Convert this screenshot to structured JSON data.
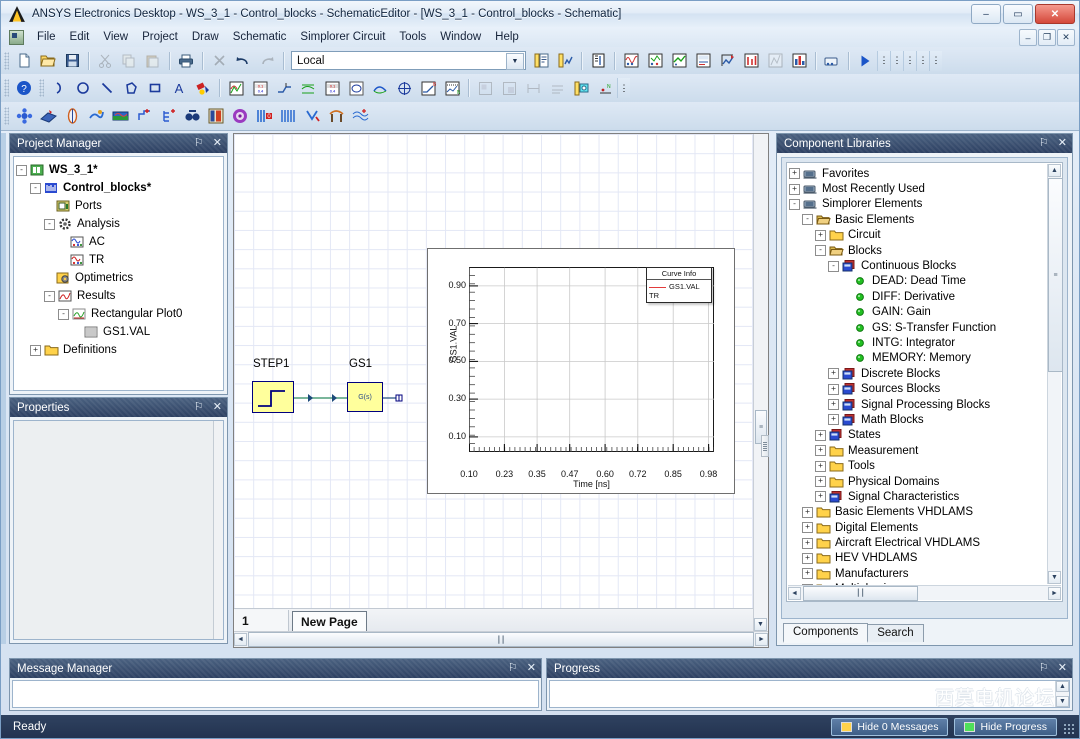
{
  "window": {
    "title": "ANSYS Electronics Desktop - WS_3_1 - Control_blocks - SchematicEditor - [WS_3_1 - Control_blocks - Schematic]",
    "logo_name": "ansys-logo",
    "minimize": "–",
    "maximize": "▭",
    "close": "✕",
    "mdi_minimize": "–",
    "mdi_restore": "❐",
    "mdi_close": "✕"
  },
  "menu": {
    "items": [
      "File",
      "Edit",
      "View",
      "Project",
      "Draw",
      "Schematic",
      "Simplorer Circuit",
      "Tools",
      "Window",
      "Help"
    ]
  },
  "toolbar": {
    "design_combo_value": "Local",
    "design_combo_placeholder": "Local",
    "row1": [
      {
        "name": "new-icon",
        "label": "New"
      },
      {
        "name": "open-icon",
        "label": "Open"
      },
      {
        "name": "save-icon",
        "label": "Save"
      },
      {
        "name": "cut-icon",
        "label": "Cut"
      },
      {
        "name": "copy-icon",
        "label": "Copy"
      },
      {
        "name": "paste-icon",
        "label": "Paste"
      },
      {
        "name": "print-icon",
        "label": "Print"
      },
      {
        "name": "delete-icon",
        "label": "Delete"
      },
      {
        "name": "undo-icon",
        "label": "Undo"
      },
      {
        "name": "redo-icon",
        "label": "Redo"
      }
    ],
    "row1b": [
      {
        "name": "validate-icon",
        "label": "Validate"
      },
      {
        "name": "analyze-all-icon",
        "label": "Analyze All"
      },
      {
        "name": "edit-notes-icon",
        "label": "Edit Notes"
      },
      {
        "name": "sim-setup-icon",
        "label": "Simulation Setup"
      },
      {
        "name": "results-icon",
        "label": "Results"
      },
      {
        "name": "solution-data-icon",
        "label": "Solution Data"
      },
      {
        "name": "output-variables-icon",
        "label": "Output Variables"
      },
      {
        "name": "param-sweep-icon",
        "label": "Parametric Sweep"
      },
      {
        "name": "optimization-icon",
        "label": "Optimization"
      },
      {
        "name": "sensitivity-icon",
        "label": "Sensitivity"
      },
      {
        "name": "statistical-icon",
        "label": "Statistical"
      },
      {
        "name": "run-icon",
        "label": "Run Simulation"
      }
    ],
    "row2": [
      {
        "name": "help-icon",
        "label": "Help"
      },
      {
        "name": "draw-arc-icon",
        "label": "Draw Arc"
      },
      {
        "name": "draw-circle-icon",
        "label": "Draw Circle"
      },
      {
        "name": "draw-line-icon",
        "label": "Draw Line"
      },
      {
        "name": "draw-polygon-icon",
        "label": "Draw Polygon"
      },
      {
        "name": "draw-rectangle-icon",
        "label": "Draw Rectangle"
      },
      {
        "name": "draw-text-icon",
        "label": "Draw Text"
      },
      {
        "name": "fill-color-icon",
        "label": "Fill Color"
      },
      {
        "name": "plot-xy-icon",
        "label": "Create Rectangular Plot"
      },
      {
        "name": "table-report-icon",
        "label": "Create Data Table"
      },
      {
        "name": "marker-icon",
        "label": "Add Marker"
      },
      {
        "name": "trace-icon",
        "label": "Add Trace"
      },
      {
        "name": "data-table-icon",
        "label": "Data Table"
      },
      {
        "name": "circle-plot-icon",
        "label": "Circle Plot"
      },
      {
        "name": "eye-diagram-icon",
        "label": "Eye Diagram"
      },
      {
        "name": "crosshair-icon",
        "label": "Crosshair"
      },
      {
        "name": "bode-plot-icon",
        "label": "Bode Plot"
      },
      {
        "name": "noise-plot-icon",
        "label": "Noise Plot"
      },
      {
        "name": "align-icon",
        "label": "Align"
      },
      {
        "name": "distribute-icon",
        "label": "Distribute"
      },
      {
        "name": "measure-icon",
        "label": "Measure"
      },
      {
        "name": "grid-icon",
        "label": "Grid"
      },
      {
        "name": "snap-icon",
        "label": "Snap"
      },
      {
        "name": "coord-icon",
        "label": "Coordinates"
      }
    ],
    "row3": [
      {
        "name": "twin-builder-icon",
        "label": "Twin Builder"
      },
      {
        "name": "maxwell-icon",
        "label": "Maxwell"
      },
      {
        "name": "hfss-icon",
        "label": "HFSS"
      },
      {
        "name": "q3d-icon",
        "label": "Q3D Extractor"
      },
      {
        "name": "icepak-icon",
        "label": "Icepak"
      },
      {
        "name": "circuit-add-icon",
        "label": "Add Circuit"
      },
      {
        "name": "netlist-add-icon",
        "label": "Add Netlist"
      },
      {
        "name": "emit-icon",
        "label": "EMIT"
      },
      {
        "name": "rmxprt-icon",
        "label": "RMxprt"
      },
      {
        "name": "pexprt-icon",
        "label": "PExprt"
      },
      {
        "name": "maxwell-2d-icon",
        "label": "Maxwell 2D"
      },
      {
        "name": "maxwell-3d-icon",
        "label": "Maxwell 3D"
      },
      {
        "name": "import-icon",
        "label": "Import"
      },
      {
        "name": "antenna-icon",
        "label": "Antenna"
      },
      {
        "name": "waveform-icon",
        "label": "Waveform"
      }
    ]
  },
  "project_manager": {
    "title": "Project Manager",
    "pin": "⚐",
    "close": "✕",
    "tree": [
      {
        "depth": 0,
        "expander": "-",
        "icon": "project-icon",
        "label": "WS_3_1*",
        "bold": true
      },
      {
        "depth": 1,
        "expander": "-",
        "icon": "design-icon",
        "label": "Control_blocks*",
        "bold": true
      },
      {
        "depth": 2,
        "expander": "",
        "icon": "ports-icon",
        "label": "Ports",
        "bold": false
      },
      {
        "depth": 2,
        "expander": "-",
        "icon": "analysis-icon",
        "label": "Analysis",
        "bold": false
      },
      {
        "depth": 3,
        "expander": "",
        "icon": "ac-setup-icon",
        "label": "AC",
        "bold": false
      },
      {
        "depth": 3,
        "expander": "",
        "icon": "tr-setup-icon",
        "label": "TR",
        "bold": false
      },
      {
        "depth": 2,
        "expander": "",
        "icon": "optimetrics-icon",
        "label": "Optimetrics",
        "bold": false
      },
      {
        "depth": 2,
        "expander": "-",
        "icon": "results-icon",
        "label": "Results",
        "bold": false
      },
      {
        "depth": 3,
        "expander": "-",
        "icon": "rect-plot-icon",
        "label": "Rectangular Plot0",
        "bold": false
      },
      {
        "depth": 4,
        "expander": "",
        "icon": "trace-icon",
        "label": "GS1.VAL",
        "bold": false
      },
      {
        "depth": 1,
        "expander": "+",
        "icon": "folder-icon",
        "label": "Definitions",
        "bold": false
      }
    ]
  },
  "properties": {
    "title": "Properties",
    "pin": "⚐",
    "close": "✕"
  },
  "component_libraries": {
    "title": "Component Libraries",
    "pin": "⚐",
    "close": "✕",
    "tree": [
      {
        "depth": 0,
        "expander": "+",
        "icon": "library-icon",
        "label": "Favorites"
      },
      {
        "depth": 0,
        "expander": "+",
        "icon": "library-icon",
        "label": "Most Recently Used"
      },
      {
        "depth": 0,
        "expander": "-",
        "icon": "library-icon",
        "label": "Simplorer Elements"
      },
      {
        "depth": 1,
        "expander": "-",
        "icon": "folder-open-icon",
        "label": "Basic Elements"
      },
      {
        "depth": 2,
        "expander": "+",
        "icon": "folder-icon",
        "label": "Circuit"
      },
      {
        "depth": 2,
        "expander": "-",
        "icon": "folder-open-icon",
        "label": "Blocks"
      },
      {
        "depth": 3,
        "expander": "-",
        "icon": "block-group-icon",
        "label": "Continuous Blocks"
      },
      {
        "depth": 4,
        "expander": "",
        "icon": "green-dot-icon",
        "label": "DEAD: Dead Time"
      },
      {
        "depth": 4,
        "expander": "",
        "icon": "green-dot-icon",
        "label": "DIFF: Derivative"
      },
      {
        "depth": 4,
        "expander": "",
        "icon": "green-dot-icon",
        "label": "GAIN: Gain"
      },
      {
        "depth": 4,
        "expander": "",
        "icon": "green-dot-icon",
        "label": "GS: S-Transfer Function"
      },
      {
        "depth": 4,
        "expander": "",
        "icon": "green-dot-icon",
        "label": "INTG: Integrator"
      },
      {
        "depth": 4,
        "expander": "",
        "icon": "green-dot-icon",
        "label": "MEMORY: Memory"
      },
      {
        "depth": 3,
        "expander": "+",
        "icon": "block-group-icon",
        "label": "Discrete Blocks"
      },
      {
        "depth": 3,
        "expander": "+",
        "icon": "block-group-icon",
        "label": "Sources Blocks"
      },
      {
        "depth": 3,
        "expander": "+",
        "icon": "block-group-icon",
        "label": "Signal Processing Blocks"
      },
      {
        "depth": 3,
        "expander": "+",
        "icon": "block-group-icon",
        "label": "Math Blocks"
      },
      {
        "depth": 2,
        "expander": "+",
        "icon": "block-group-icon",
        "label": "States"
      },
      {
        "depth": 2,
        "expander": "+",
        "icon": "folder-icon",
        "label": "Measurement"
      },
      {
        "depth": 2,
        "expander": "+",
        "icon": "folder-icon",
        "label": "Tools"
      },
      {
        "depth": 2,
        "expander": "+",
        "icon": "folder-icon",
        "label": "Physical Domains"
      },
      {
        "depth": 2,
        "expander": "+",
        "icon": "block-group-icon",
        "label": "Signal Characteristics"
      },
      {
        "depth": 1,
        "expander": "+",
        "icon": "folder-icon",
        "label": "Basic Elements VHDLAMS"
      },
      {
        "depth": 1,
        "expander": "+",
        "icon": "folder-icon",
        "label": "Digital Elements"
      },
      {
        "depth": 1,
        "expander": "+",
        "icon": "folder-icon",
        "label": "Aircraft Electrical VHDLAMS"
      },
      {
        "depth": 1,
        "expander": "+",
        "icon": "folder-icon",
        "label": "HEV VHDLAMS"
      },
      {
        "depth": 1,
        "expander": "+",
        "icon": "folder-icon",
        "label": "Manufacturers"
      },
      {
        "depth": 1,
        "expander": "+",
        "icon": "folder-icon",
        "label": "Multiphysics"
      }
    ],
    "tabs": [
      {
        "label": "Components",
        "active": true
      },
      {
        "label": "Search",
        "active": false
      }
    ]
  },
  "schematic": {
    "components": [
      {
        "name": "STEP1",
        "type": "step-source"
      },
      {
        "name": "GS1",
        "type": "s-transfer-function",
        "body_label": "G(s)"
      }
    ],
    "page_number": "1",
    "page_tab": "New Page"
  },
  "chart_data": {
    "type": "line",
    "title": "",
    "xlabel": "Time [ns]",
    "ylabel": "GS1.VAL",
    "xlim": [
      0.1,
      1.0
    ],
    "ylim": [
      0.02,
      1.0
    ],
    "xticks": [
      "0.10",
      "0.23",
      "0.35",
      "0.47",
      "0.60",
      "0.72",
      "0.85",
      "0.98"
    ],
    "xtick_values": [
      0.1,
      0.23,
      0.35,
      0.47,
      0.6,
      0.72,
      0.85,
      0.98
    ],
    "yticks": [
      "0.10",
      "0.30",
      "0.50",
      "0.70",
      "0.90"
    ],
    "ytick_values": [
      0.1,
      0.3,
      0.5,
      0.7,
      0.9
    ],
    "grid": true,
    "legend": {
      "title": "Curve Info",
      "position": "top-right",
      "entries": [
        {
          "name": "GS1.VAL",
          "sub": "TR",
          "color": "#e23b3b"
        }
      ]
    },
    "series": [
      {
        "name": "GS1.VAL",
        "color": "#1a1a1a",
        "x": [
          0.1,
          0.23,
          0.35,
          0.47,
          0.6,
          0.72,
          0.85,
          0.98,
          1.0
        ],
        "values": [
          1.0,
          1.0,
          1.0,
          1.0,
          1.0,
          1.0,
          1.0,
          1.0,
          1.0
        ]
      }
    ]
  },
  "message_manager": {
    "title": "Message Manager",
    "pin": "⚐",
    "close": "✕"
  },
  "progress": {
    "title": "Progress",
    "pin": "⚐",
    "close": "✕",
    "watermark": "西莫电机论坛"
  },
  "statusbar": {
    "text": "Ready",
    "hide_messages": "Hide 0 Messages",
    "hide_progress": "Hide Progress"
  },
  "colors": {
    "accent": "#2d4062",
    "block_fill": "#ffff9c",
    "block_stroke": "#00007f",
    "wire": "#4f9e7a",
    "trace": "#e23b3b"
  }
}
